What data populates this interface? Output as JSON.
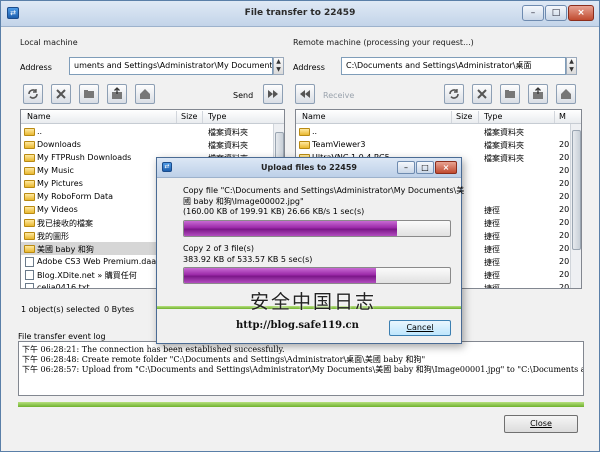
{
  "window": {
    "title": "File transfer to 22459",
    "minimize": "–",
    "maximize": "□",
    "close": "×"
  },
  "local": {
    "label": "Local machine",
    "address_label": "Address",
    "address_value": "uments and Settings\\Administrator\\My Documents",
    "send_label": "Send",
    "columns": {
      "name": "Name",
      "size": "Size",
      "type": "Type"
    },
    "rows": [
      {
        "name": "..",
        "type": "檔案資料夾",
        "icon": "folder"
      },
      {
        "name": "Downloads",
        "type": "檔案資料夾",
        "icon": "folder"
      },
      {
        "name": "My FTPRush Downloads",
        "type": "檔案資料夾",
        "icon": "folder"
      },
      {
        "name": "My Music",
        "type": "檔案資料夾",
        "icon": "folder"
      },
      {
        "name": "My Pictures",
        "type": "檔案資料夾",
        "icon": "folder"
      },
      {
        "name": "My RoboForm Data",
        "type": "檔案資料夾",
        "icon": "folder"
      },
      {
        "name": "My Videos",
        "type": "檔案資料夾",
        "icon": "folder"
      },
      {
        "name": "我已接收的檔案",
        "type": "檔案資料夾",
        "icon": "folder"
      },
      {
        "name": "我的圖形",
        "type": "檔案資料夾",
        "icon": "folder"
      },
      {
        "name": "美國 baby 和狗",
        "type": "檔案資料夾",
        "icon": "folder"
      },
      {
        "name": "Adobe CS3 Web Premium.daa",
        "type": "",
        "icon": "file"
      },
      {
        "name": "Blog.XDite.net » 購買任何",
        "type": "",
        "icon": "file"
      },
      {
        "name": "celia0416.txt",
        "type": "",
        "icon": "file"
      }
    ],
    "status_selected": "1 object(s) selected",
    "status_bytes": "0 Bytes"
  },
  "remote": {
    "label": "Remote machine (processing your request...)",
    "address_label": "Address",
    "address_value": "C:\\Documents and Settings\\Administrator\\桌面",
    "receive_label": "Receive",
    "columns": {
      "name": "Name",
      "size": "Size",
      "type": "Type",
      "modified": "M"
    },
    "rows": [
      {
        "name": "..",
        "type": "檔案資料夾",
        "mod": "",
        "icon": "folder"
      },
      {
        "name": "TeamViewer3",
        "type": "檔案資料夾",
        "mod": "20",
        "icon": "folder"
      },
      {
        "name": "UltraVNC 1.0.4 RC5",
        "type": "檔案資料夾",
        "mod": "20",
        "icon": "folder"
      },
      {
        "name": "",
        "type": "",
        "mod": "20",
        "icon": "none"
      },
      {
        "name": "",
        "type": "",
        "mod": "20",
        "icon": "none"
      },
      {
        "name": "",
        "type": "",
        "mod": "20",
        "icon": "none"
      },
      {
        "name": "",
        "type": "捷徑",
        "mod": "20",
        "icon": "none"
      },
      {
        "name": "",
        "type": "捷徑",
        "mod": "20",
        "icon": "none"
      },
      {
        "name": "",
        "type": "捷徑",
        "mod": "20",
        "icon": "none"
      },
      {
        "name": "",
        "type": "捷徑",
        "mod": "20",
        "icon": "none"
      },
      {
        "name": "",
        "type": "捷徑",
        "mod": "20",
        "icon": "none"
      },
      {
        "name": "",
        "type": "捷徑",
        "mod": "20",
        "icon": "none"
      },
      {
        "name": "",
        "type": "捷徑",
        "mod": "20",
        "icon": "none"
      }
    ]
  },
  "log": {
    "title": "File transfer event log",
    "lines": [
      "下午 06:28:21: The connection has been established successfully.",
      "下午 06:28:48: Create remote folder \"C:\\Documents and Settings\\Administrator\\桌面\\美國 baby 和狗\"",
      "下午 06:28:57: Upload from \"C:\\Documents and Settings\\Administrator\\My Documents\\美國 baby 和狗\\Image00001.jpg\" to \"C:\\Documents and Setti"
    ]
  },
  "close_button": "Close",
  "dialog": {
    "title": "Upload files to 22459",
    "copy_line1": "Copy file \"C:\\Documents and Settings\\Administrator\\My Documents\\美",
    "copy_line2": "國 baby 和狗\\Image00002.jpg\"",
    "copy_stats": "(160.00 KB of 199.91 KB)   26.66 KB/s   1 sec(s)",
    "file_progress": 0.8,
    "count_line": "Copy 2 of 3 file(s)",
    "count_stats": "383.92 KB of 533.57 KB    5 sec(s)",
    "total_progress": 0.72,
    "cancel": "Cancel"
  },
  "watermark": {
    "cn": "安全中国日志",
    "url": "http://blog.safe119.cn"
  }
}
